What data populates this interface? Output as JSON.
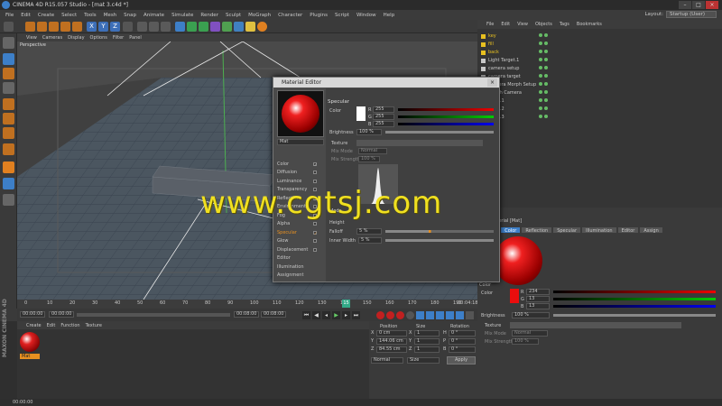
{
  "titlebar": {
    "title": "CINEMA 4D R15.057 Studio - [mat 3.c4d *]",
    "min": "–",
    "max": "□",
    "close": "×"
  },
  "menubar": {
    "items": [
      "File",
      "Edit",
      "Create",
      "Select",
      "Tools",
      "Mesh",
      "Snap",
      "Animate",
      "Simulate",
      "Render",
      "Sculpt",
      "MoGraph",
      "Character",
      "Plugins",
      "Script",
      "Window",
      "Help"
    ],
    "layout_label": "Layout:",
    "layout_value": "Startup (User)"
  },
  "toolbar": {
    "axis_x": "X",
    "axis_y": "Y",
    "axis_z": "Z"
  },
  "viewport": {
    "menu": [
      "View",
      "Cameras",
      "Display",
      "Options",
      "Filter",
      "Panel"
    ],
    "label": "Perspective"
  },
  "timeline": {
    "ticks": [
      "0",
      "10",
      "20",
      "30",
      "40",
      "50",
      "60",
      "70",
      "80",
      "90",
      "100",
      "110",
      "120",
      "130",
      "140",
      "150",
      "160",
      "170",
      "180",
      "190"
    ],
    "playhead": "15",
    "end_frame": "00:04:18"
  },
  "transport": {
    "start": "00:00:00",
    "current": "00:00:00",
    "end_a": "00:08:00",
    "end_b": "00:08:00"
  },
  "material_manager": {
    "menu": [
      "Create",
      "Edit",
      "Function",
      "Texture"
    ],
    "mat_name": "Mat"
  },
  "coordinates": {
    "headers": [
      "Position",
      "Size",
      "Rotation"
    ],
    "rows": [
      {
        "axis": "X",
        "pos": "0 cm",
        "size": "1",
        "rot_axis": "H",
        "rot": "0 °"
      },
      {
        "axis": "Y",
        "pos": "144.06 cm",
        "size": "1",
        "rot_axis": "P",
        "rot": "0 °"
      },
      {
        "axis": "Z",
        "pos": "84.55 cm",
        "size": "1",
        "rot_axis": "B",
        "rot": "0 °"
      }
    ],
    "mode_a": "Normal",
    "mode_b": "Size",
    "apply": "Apply"
  },
  "objects": {
    "menu": [
      "File",
      "Edit",
      "View",
      "Objects",
      "Tags",
      "Bookmarks"
    ],
    "items": [
      {
        "name": "key",
        "color": "#e8c020"
      },
      {
        "name": "fill",
        "color": "#e8c020"
      },
      {
        "name": "back",
        "color": "#e8c020"
      },
      {
        "name": "Light Target.1",
        "color": "#c8c8c8"
      },
      {
        "name": "camera setup",
        "color": "#c8c8c8"
      },
      {
        "name": "camera target",
        "color": "#c8c8c8"
      },
      {
        "name": "Camera Morph Setup",
        "color": "#c8c8c8"
      },
      {
        "name": "Morph Camera",
        "color": "#c8c8c8"
      },
      {
        "name": "Cube.1",
        "color": "#c8c8c8"
      },
      {
        "name": "Cube.2",
        "color": "#c8c8c8"
      },
      {
        "name": "Cube.3",
        "color": "#c8c8c8"
      }
    ]
  },
  "material_editor": {
    "title": "Material Editor",
    "mat_name": "Mat",
    "channels": [
      {
        "name": "Color",
        "on": true
      },
      {
        "name": "Diffusion",
        "on": false
      },
      {
        "name": "Luminance",
        "on": false
      },
      {
        "name": "Transparency",
        "on": false
      },
      {
        "name": "Reflection",
        "on": true
      },
      {
        "name": "Environment",
        "on": false
      },
      {
        "name": "Fog",
        "on": false
      },
      {
        "name": "Alpha",
        "on": false
      },
      {
        "name": "Specular",
        "on": true
      },
      {
        "name": "Glow",
        "on": false
      },
      {
        "name": "Displacement",
        "on": false
      },
      {
        "name": "Editor",
        "on": null
      },
      {
        "name": "Illumination",
        "on": null
      },
      {
        "name": "Assignment",
        "on": null
      }
    ],
    "section": "Specular",
    "color_label": "Color",
    "r": "255",
    "g": "255",
    "b": "255",
    "brightness_label": "Brightness",
    "brightness": "100 %",
    "texture_label": "Texture",
    "mix_mode_label": "Mix Mode",
    "mix_mode": "Normal",
    "mix_strength_label": "Mix Strength",
    "mix_strength": "100 %",
    "mode_label": "Mode",
    "height_label": "Height",
    "falloff_label": "Falloff",
    "falloff": "5 %",
    "inner_width_label": "Inner Width",
    "inner_width": "5 %"
  },
  "attributes": {
    "title": "Material [Mat]",
    "tabs": [
      "Basic",
      "Color",
      "Reflection",
      "Specular",
      "Illumination",
      "Editor",
      "Assign"
    ],
    "active_tab": "Color",
    "section": "Color",
    "color_label": "Color",
    "r": "234",
    "g": "13",
    "b": "13",
    "brightness_label": "Brightness",
    "brightness": "100 %",
    "texture_label": "Texture",
    "mix_mode_label": "Mix Mode",
    "mix_mode": "Normal",
    "mix_strength_label": "Mix Strength",
    "mix_strength": "100 %"
  },
  "watermark": "www.cgtsj.com",
  "statusbar": {
    "time": "00:00:00"
  },
  "brand": "MAXON CINEMA 4D",
  "colors": {
    "accent": "#3d7fc8",
    "material_red": "#d01818",
    "highlight_orange": "#e89020",
    "watermark": "#f0e020"
  }
}
